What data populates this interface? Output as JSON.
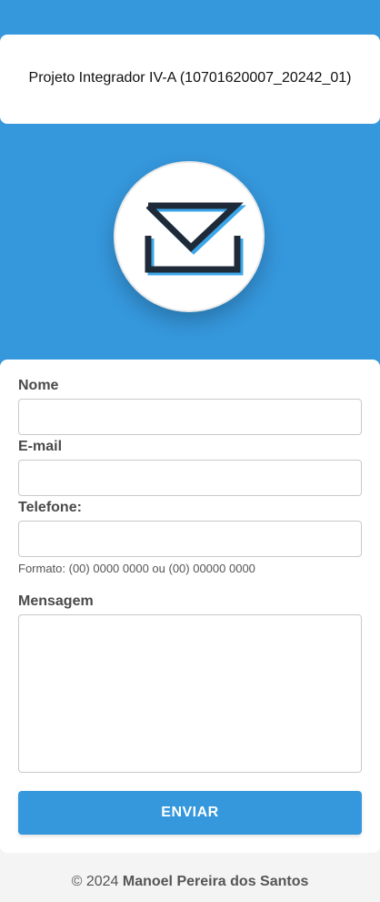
{
  "header": {
    "title": "Projeto Integrador IV-A (10701620007_20242_01)"
  },
  "logo": {
    "icon": "envelope-icon"
  },
  "form": {
    "name_label": "Nome",
    "email_label": "E-mail",
    "phone_label": "Telefone:",
    "phone_hint": "Formato: (00) 0000 0000 ou (00) 00000 0000",
    "message_label": "Mensagem",
    "name_value": "",
    "email_value": "",
    "phone_value": "",
    "message_value": "",
    "submit_label": "ENVIAR"
  },
  "footer": {
    "copyright": "© 2024",
    "author": "Manoel Pereira dos Santos"
  },
  "colors": {
    "primary": "#3597dc",
    "background": "#f4f4f4",
    "card": "#ffffff",
    "label_text": "#4a4a4a",
    "icon_dark": "#1f2a38"
  }
}
